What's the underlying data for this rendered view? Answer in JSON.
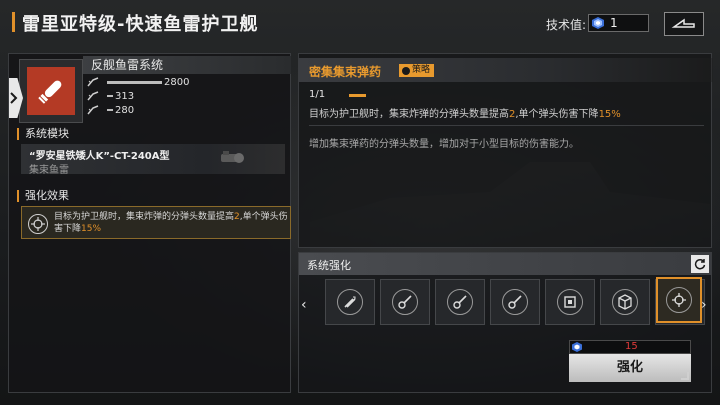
{
  "header": {
    "title": "雷里亚特级-快速鱼雷护卫舰",
    "tech_label": "技术值:",
    "tech_value": "1"
  },
  "system": {
    "name": "反舰鱼雷系统",
    "stats": [
      {
        "icon": "bar-icon",
        "value": "2800"
      },
      {
        "icon": "angle-icon",
        "value": "313"
      },
      {
        "icon": "angle-icon",
        "value": "280"
      }
    ]
  },
  "module_section": {
    "heading": "系统模块",
    "name": "“罗安星铁矮人K”-CT-240A型",
    "type": "集束鱼雷"
  },
  "effect_section": {
    "heading": "强化效果",
    "text_a": "目标为护卫舰时，集束炸弹的分弹头数量提高",
    "num_a": "2",
    "text_b": ",单个弹头伤害下降",
    "num_b": "15%"
  },
  "detail": {
    "name": "密集集束弹药",
    "badge": "策略",
    "level": "1/1",
    "desc_a": "目标为护卫舰时，集束炸弹的分弹头数量提高",
    "desc_num_a": "2",
    "desc_b": ",单个弹头伤害下降",
    "desc_num_b": "15%",
    "sub": "增加集束弹药的分弹头数量，增加对于小型目标的伤害能力。"
  },
  "enhance": {
    "title": "系统强化",
    "slots": [
      "missile-icon",
      "guitar-icon",
      "guitar-icon",
      "guitar-icon",
      "chip-icon",
      "box-icon",
      "drone-icon",
      "target-icon"
    ],
    "cost": "15",
    "button": "强化"
  },
  "colors": {
    "accent": "#e0902a",
    "cost_red": "#e03a3a",
    "icon_red": "#b43a25"
  }
}
